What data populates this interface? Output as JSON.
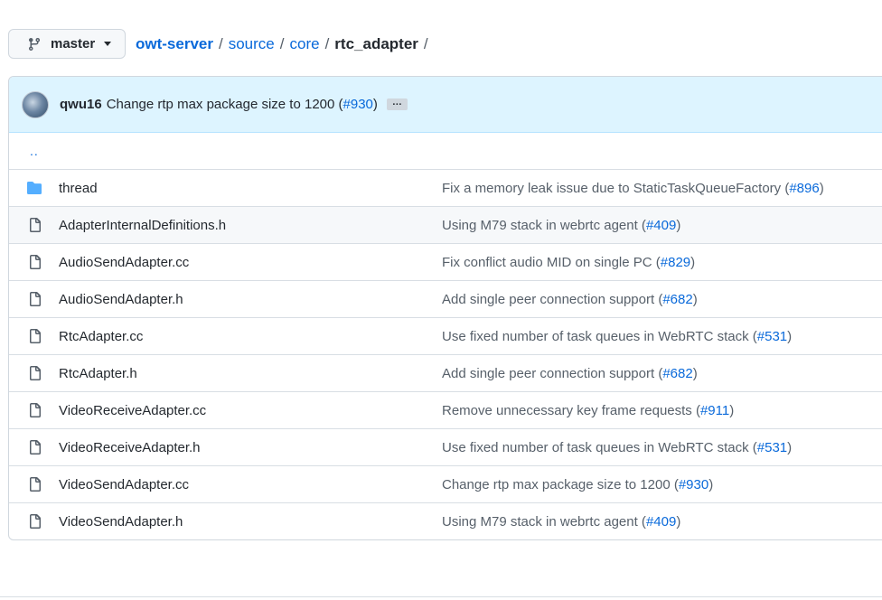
{
  "branch": {
    "label": "master",
    "icon": "git-branch-icon"
  },
  "breadcrumb": {
    "repo": "owt-server",
    "segments": [
      "source",
      "core"
    ],
    "current": "rtc_adapter",
    "separator": "/"
  },
  "commit": {
    "author": "qwu16",
    "message_prefix": "Change rtp max package size to 1200 (",
    "pr": "#930",
    "message_suffix": ")",
    "ellipsis": "…"
  },
  "parent_dir": "..",
  "files": [
    {
      "name": "thread",
      "type": "folder",
      "icon": "folder-icon",
      "msg": "Fix a memory leak issue due to StaticTaskQueueFactory (",
      "pr": "#896",
      "end": ")"
    },
    {
      "name": "AdapterInternalDefinitions.h",
      "type": "file",
      "icon": "file-icon",
      "msg": "Using M79 stack in webrtc agent (",
      "pr": "#409",
      "end": ")"
    },
    {
      "name": "AudioSendAdapter.cc",
      "type": "file",
      "icon": "file-icon",
      "msg": "Fix conflict audio MID on single PC (",
      "pr": "#829",
      "end": ")"
    },
    {
      "name": "AudioSendAdapter.h",
      "type": "file",
      "icon": "file-icon",
      "msg": "Add single peer connection support (",
      "pr": "#682",
      "end": ")"
    },
    {
      "name": "RtcAdapter.cc",
      "type": "file",
      "icon": "file-icon",
      "msg": "Use fixed number of task queues in WebRTC stack (",
      "pr": "#531",
      "end": ")"
    },
    {
      "name": "RtcAdapter.h",
      "type": "file",
      "icon": "file-icon",
      "msg": "Add single peer connection support (",
      "pr": "#682",
      "end": ")"
    },
    {
      "name": "VideoReceiveAdapter.cc",
      "type": "file",
      "icon": "file-icon",
      "msg": "Remove unnecessary key frame requests (",
      "pr": "#911",
      "end": ")"
    },
    {
      "name": "VideoReceiveAdapter.h",
      "type": "file",
      "icon": "file-icon",
      "msg": "Use fixed number of task queues in WebRTC stack (",
      "pr": "#531",
      "end": ")"
    },
    {
      "name": "VideoSendAdapter.cc",
      "type": "file",
      "icon": "file-icon",
      "msg": "Change rtp max package size to 1200 (",
      "pr": "#930",
      "end": ")"
    },
    {
      "name": "VideoSendAdapter.h",
      "type": "file",
      "icon": "file-icon",
      "msg": "Using M79 stack in webrtc agent (",
      "pr": "#409",
      "end": ")"
    }
  ],
  "colors": {
    "link": "#0969da",
    "folder": "#54aeff",
    "commit_bg": "#ddf4ff"
  }
}
